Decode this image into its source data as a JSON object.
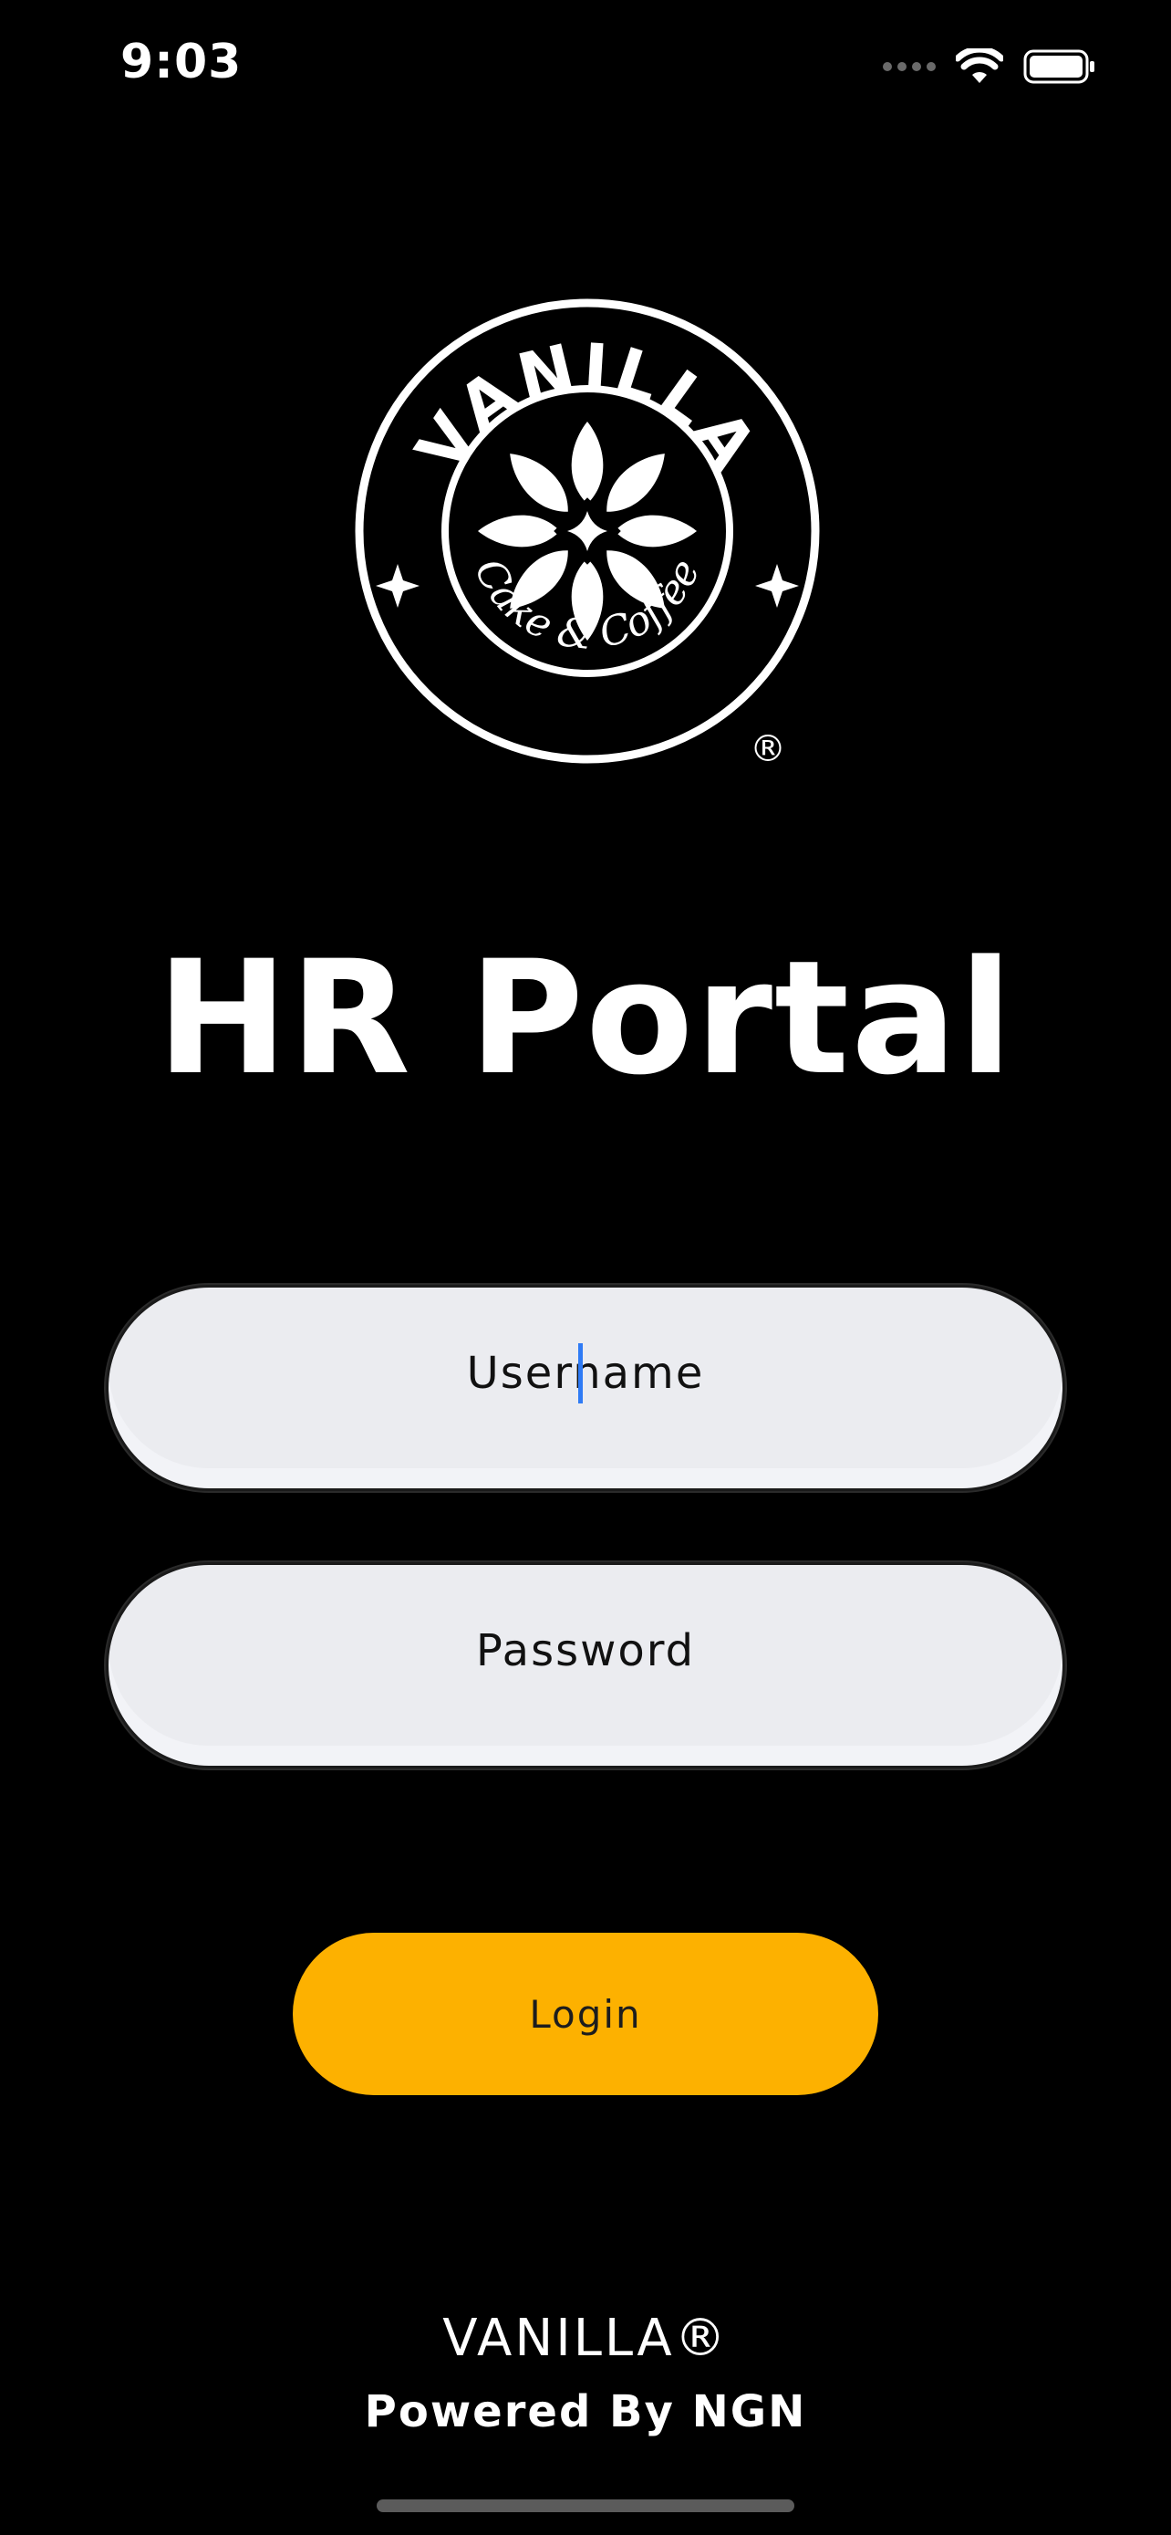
{
  "status_bar": {
    "time": "9:03",
    "icons": [
      "signal-dots-icon",
      "wifi-icon",
      "battery-icon"
    ]
  },
  "logo": {
    "name": "vanilla-cake-coffee-logo",
    "brand_text": "VANILLA",
    "tagline": "Cake & Coffee",
    "registered": "®"
  },
  "title": "HR Portal",
  "form": {
    "username_placeholder": "Username",
    "password_placeholder": "Password",
    "login_label": "Login"
  },
  "footer": {
    "brand": "VANILLA®",
    "powered_by": "Powered By NGN"
  },
  "colors": {
    "background": "#000000",
    "accent": "#fdb100",
    "field": "#ebecf0",
    "caret": "#2f7bf5"
  }
}
